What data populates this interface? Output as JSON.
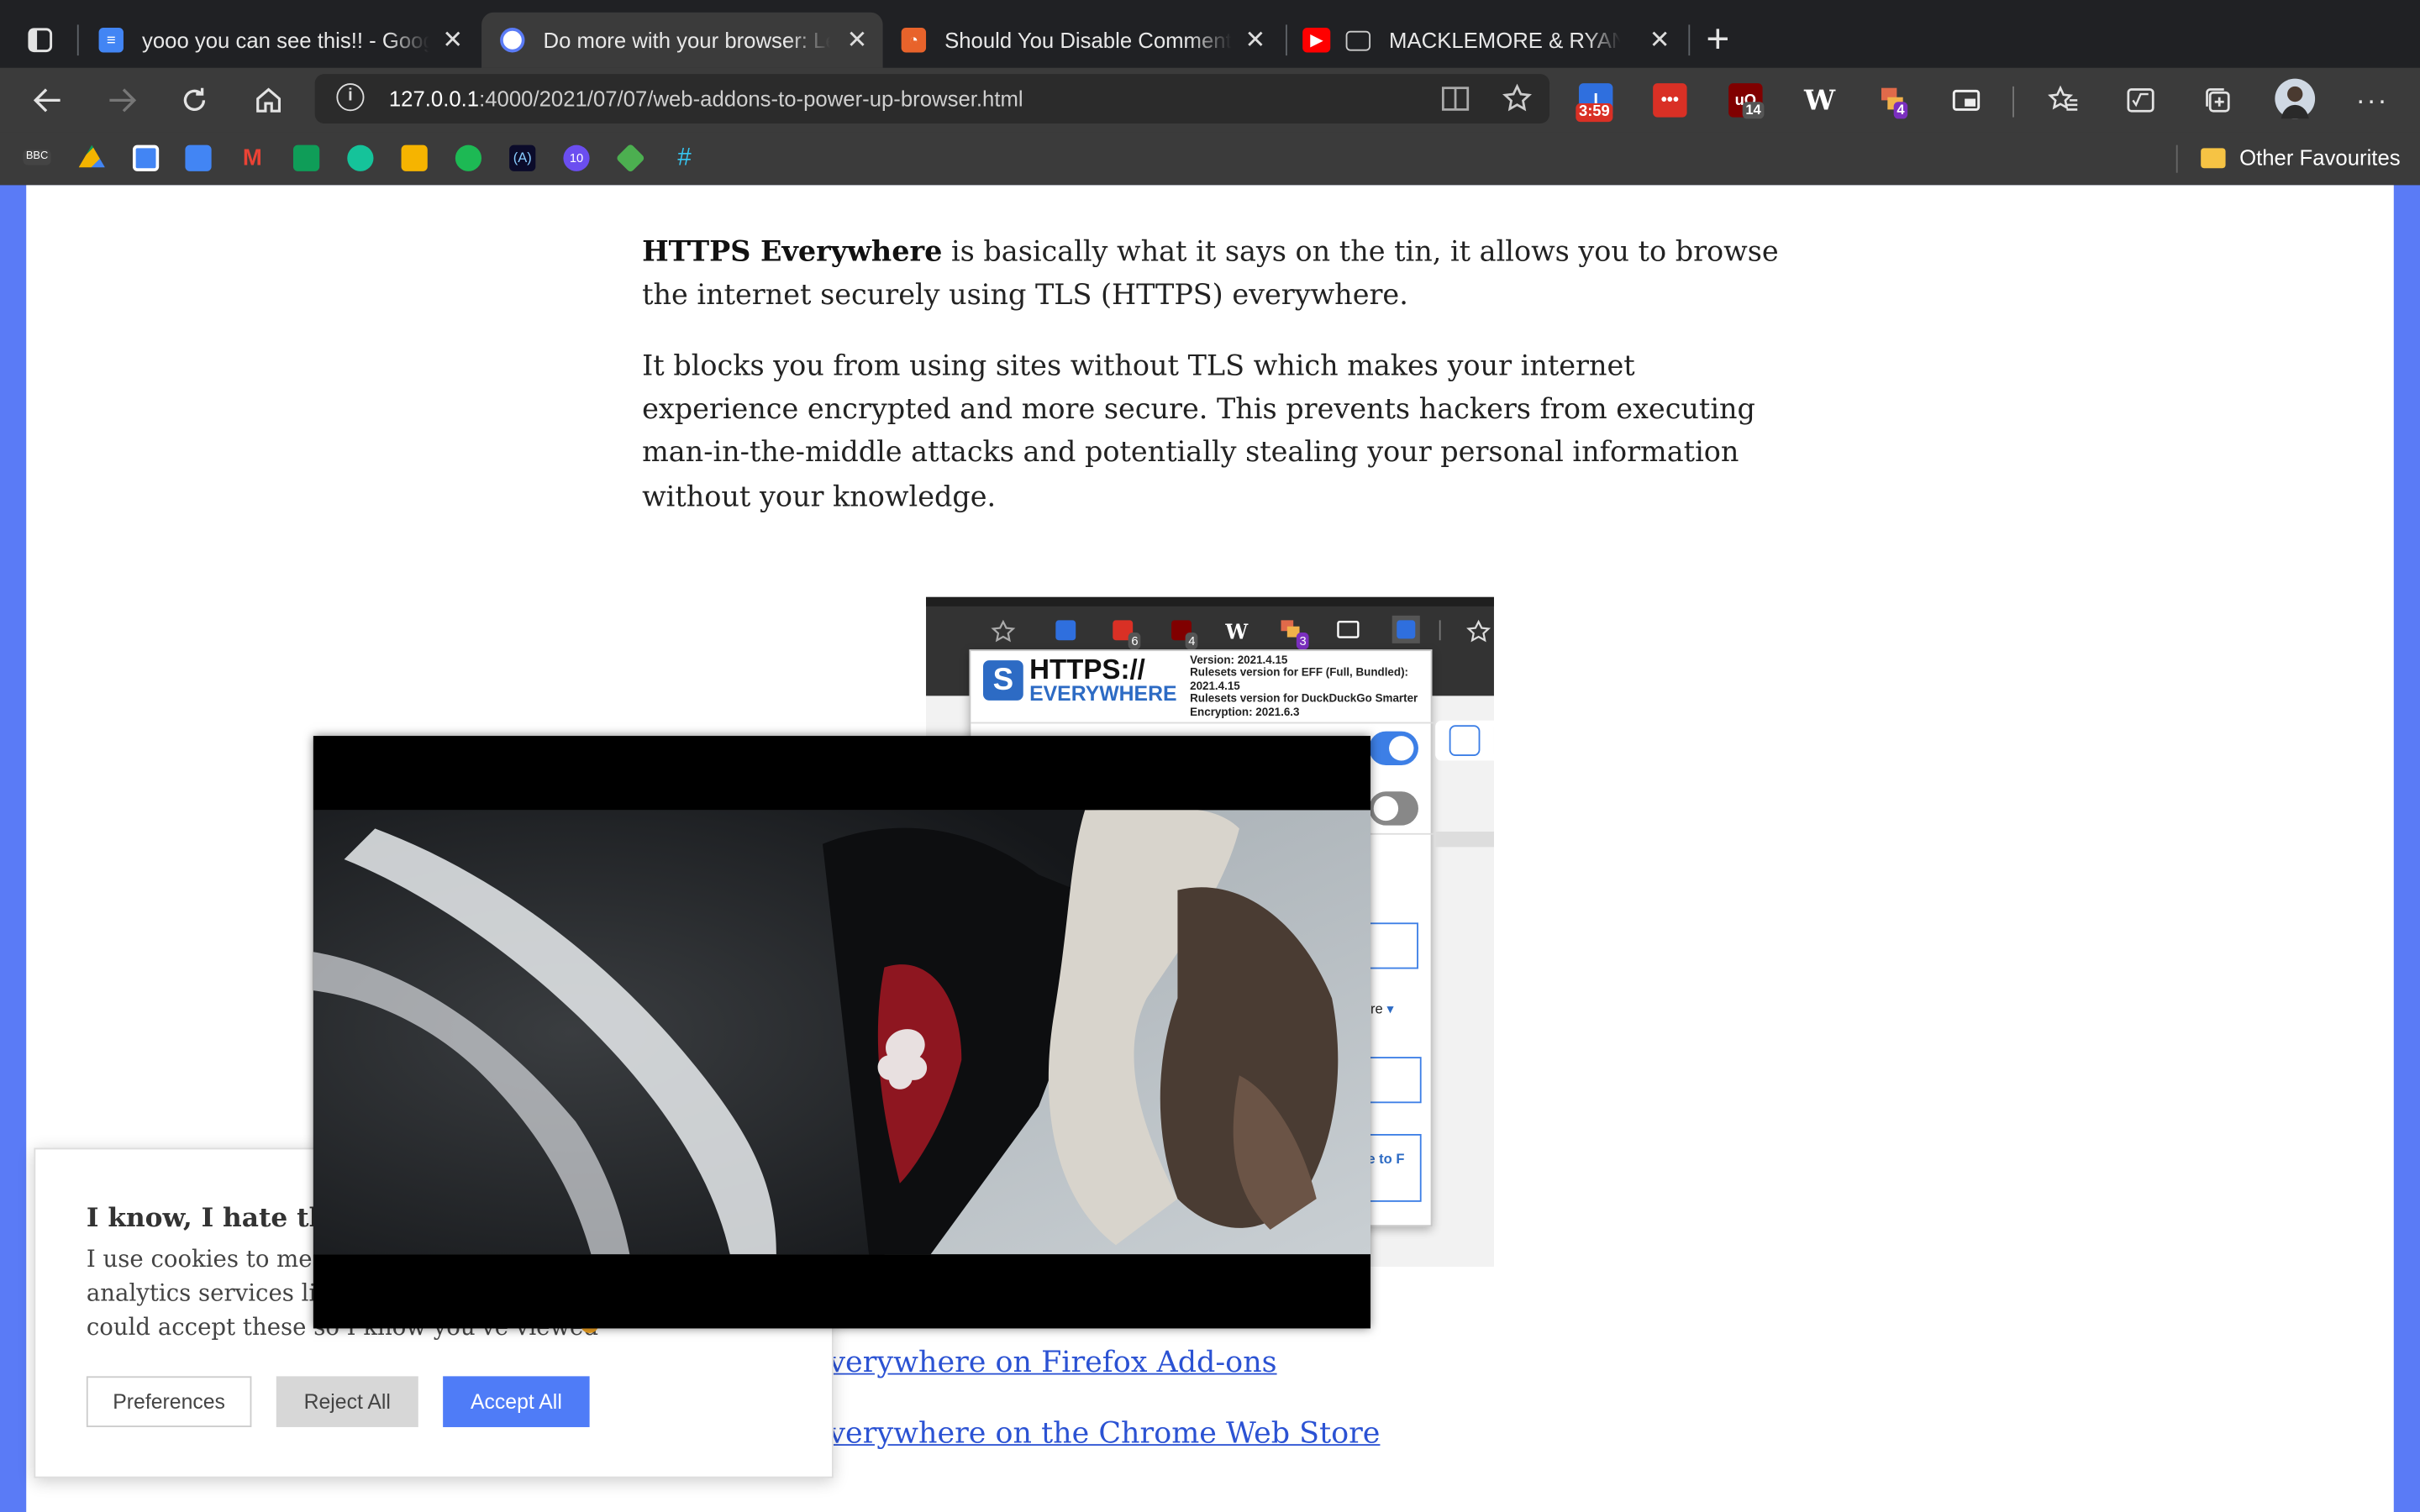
{
  "tabs": [
    {
      "title": "yooo you can see this!! - Google",
      "favicon": "google-docs-icon",
      "color": "#4285f4"
    },
    {
      "title": "Do more with your browser: Le",
      "favicon": "site-logo-icon",
      "color": "#5a7bf6"
    },
    {
      "title": "Should You Disable Comments",
      "favicon": "feed-icon",
      "color": "#e8632b"
    },
    {
      "title": "MACKLEMORE & RYAN LE",
      "favicon": "youtube-icon",
      "color": "#ff0000"
    }
  ],
  "address_bar": {
    "host": "127.0.0.1",
    "path": ":4000/2021/07/07/web-addons-to-power-up-browser.html"
  },
  "extensions": {
    "timer_badge": "3:59",
    "ublock_badge": "14",
    "bookmark_badge": "4",
    "wikipedia_label": "W"
  },
  "bookmarks_bar": {
    "other_favourites": "Other Favourites"
  },
  "article": {
    "p1_bold": "HTTPS Everywhere",
    "p1_rest": " is basically what it says on the tin, it allows you to browse the internet securely using TLS (HTTPS) everywhere.",
    "p2": "It blocks you from using sites without TLS which makes your internet experience encrypted and more secure. This prevents hackers from executing man-in-the-middle attacks and potentially stealing your personal information without your knowledge.",
    "link_firefox": "verywhere on Firefox Add-ons",
    "link_chrome": "verywhere on the Chrome Web Store"
  },
  "https_screenshot": {
    "logo_top": "HTTPS://",
    "logo_bottom": "EVERYWHERE",
    "version": "Version: 2021.4.15",
    "rulesets_eff": "Rulesets version for EFF (Full, Bundled): 2021.4.15",
    "rulesets_ddg": "Rulesets version for DuckDuckGo Smarter Encryption: 2021.6.3",
    "more_text": "ore",
    "button_text": "e to F",
    "ext_badges": [
      "6",
      "4",
      "3"
    ]
  },
  "cookie_banner": {
    "title": "I know, I hate this to",
    "text_line1": "I use cookies to meas",
    "text_line2": "analytics services like",
    "text_line3": "could accept these so I know you've viewed",
    "preferences": "Preferences",
    "reject": "Reject All",
    "accept": "Accept All",
    "accent": "#4f7cf7"
  }
}
